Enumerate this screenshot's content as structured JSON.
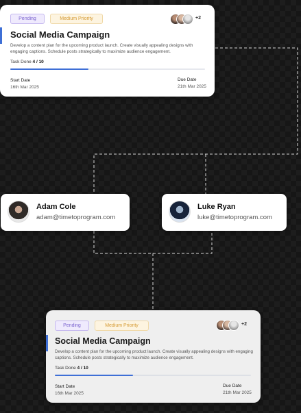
{
  "task_cards": [
    {
      "status": "Pending",
      "priority": "Medium Priority",
      "assignees_more": "+2",
      "title": "Social Media Campaign",
      "description": "Develop a content plan for the upcoming product launch. Create visually appealing designs with engaging captions. Schedule posts strategically to maximize audience engagement.",
      "task_done_label": "Task Done",
      "task_done_value": "4 / 10",
      "progress_fraction": 0.4,
      "start_label": "Start Date",
      "start_date": "16th Mar 2025",
      "due_label": "Due Date",
      "due_date": "21th Mar 2025"
    },
    {
      "status": "Pending",
      "priority": "Medium Priority",
      "assignees_more": "+2",
      "title": "Social Media Campaign",
      "description": "Develop a content plan for the upcoming product launch. Create visually appealing designs with engaging captions. Schedule posts strategically to maximize audience engagement.",
      "task_done_label": "Task Done",
      "task_done_value": "4 / 10",
      "progress_fraction": 0.4,
      "start_label": "Start Date",
      "start_date": "16th Mar 2025",
      "due_label": "Due Date",
      "due_date": "21th Mar 2025"
    }
  ],
  "people": [
    {
      "name": "Adam Cole",
      "email": "adam@timetoprogram.com"
    },
    {
      "name": "Luke Ryan",
      "email": "luke@timetoprogram.com"
    }
  ],
  "colors": {
    "accent": "#3e6fd6",
    "pending": "#7a63cf",
    "priority": "#d59a33",
    "background": "#161616"
  }
}
